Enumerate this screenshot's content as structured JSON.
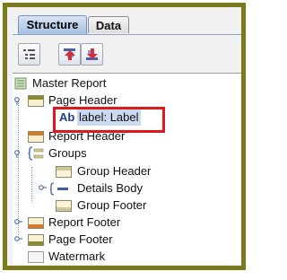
{
  "tabs": [
    {
      "label": "Structure",
      "active": true
    },
    {
      "label": "Data",
      "active": false
    }
  ],
  "toolbar": {
    "buttons": [
      "list-view-icon",
      "move-up-icon",
      "move-down-icon"
    ]
  },
  "tree": {
    "master_report": "Master Report",
    "page_header": "Page Header",
    "label_prefix": "Ab",
    "label_item": "label: Label",
    "report_header": "Report Header",
    "groups": "Groups",
    "group_header": "Group Header",
    "details_body": "Details Body",
    "group_footer": "Group Footer",
    "report_footer": "Report Footer",
    "page_footer": "Page Footer",
    "watermark": "Watermark"
  },
  "colors": {
    "frame_border": "#7d7a1c",
    "highlight_box": "#e0171b",
    "selection": "#cad9ef"
  }
}
